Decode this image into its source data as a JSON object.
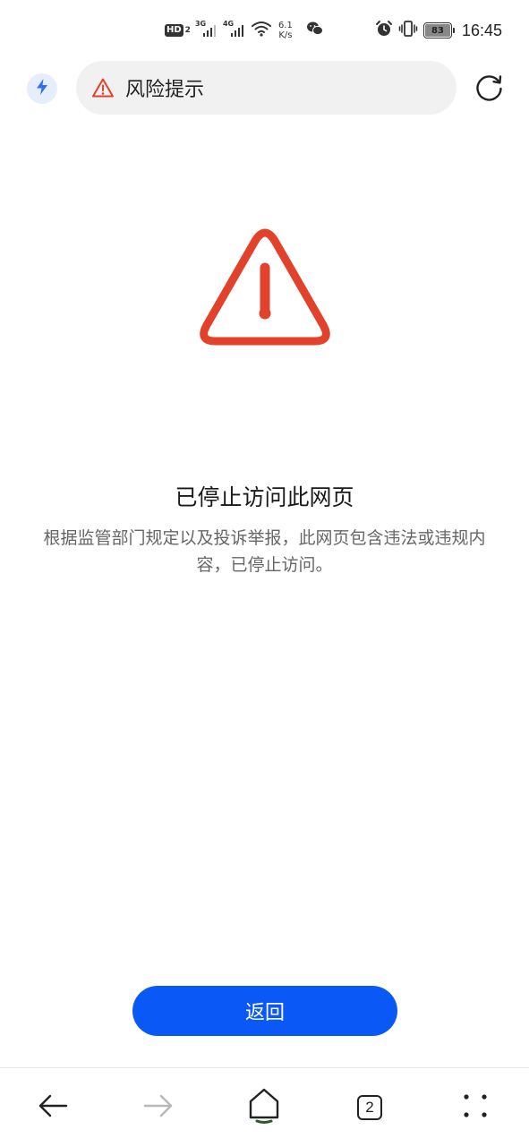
{
  "status_bar": {
    "hd_label": "HD",
    "hd_sub": "2",
    "signal1_gen": "3G",
    "signal2_gen": "4G",
    "net_speed_value": "6.1",
    "net_speed_unit": "K/s",
    "battery_level": "83",
    "time": "16:45"
  },
  "address_bar": {
    "title": "风险提示"
  },
  "main": {
    "headline": "已停止访问此网页",
    "description": "根据监管部门规定以及投诉举报，此网页包含违法或违规内容，已停止访问。"
  },
  "back_button": {
    "label": "返回"
  },
  "bottom_nav": {
    "tab_count": "2"
  },
  "colors": {
    "warning_red": "#e2412b",
    "primary_blue": "#0a59f7",
    "flash_icon_blue": "#2f6ff0"
  },
  "icons": {
    "flash": "lightning-icon",
    "warning_small": "warning-triangle-icon",
    "refresh": "refresh-icon",
    "warning_large": "warning-triangle-icon",
    "back": "arrow-left-icon",
    "forward": "arrow-right-icon",
    "home": "home-icon",
    "more": "more-dots-icon"
  }
}
